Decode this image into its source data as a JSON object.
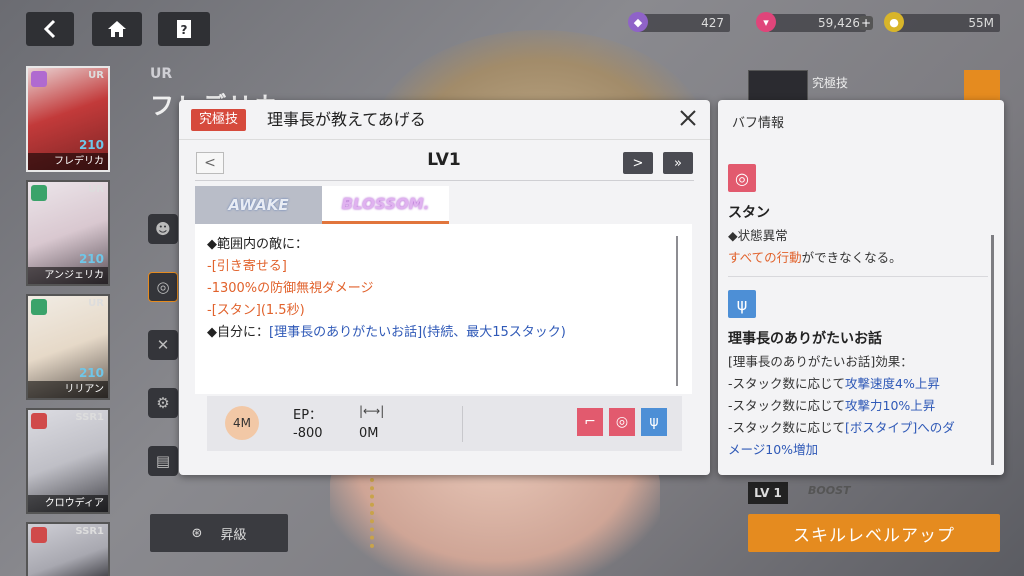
{
  "topbar": {
    "back_icon": "chevron-left-icon",
    "home_icon": "home-icon",
    "help_icon": "help-icon",
    "resources": [
      {
        "name": "gem",
        "value": "427",
        "color": "#8f63c8"
      },
      {
        "name": "ticket",
        "value": "59,426",
        "color": "#e0457a"
      },
      {
        "name": "gold",
        "value": "55M",
        "color": "#d8b52a"
      }
    ]
  },
  "roster": [
    {
      "rarity": "UR",
      "level": "210",
      "name": "フレデリカ",
      "element_color": "#b06ad0",
      "art_color": "#c23a3a",
      "selected": true
    },
    {
      "rarity": "UR",
      "level": "210",
      "name": "アンジェリカ",
      "element_color": "#3aa36a",
      "art_color": "#d9c8d0",
      "selected": false
    },
    {
      "rarity": "UR",
      "level": "210",
      "name": "リリアン",
      "element_color": "#3aa36a",
      "art_color": "#e6d9c8",
      "selected": false
    },
    {
      "rarity": "SSR1",
      "level": "",
      "name": "クロウディア",
      "element_color": "#d04a4a",
      "art_color": "#bfbfc6",
      "selected": false
    },
    {
      "rarity": "SSR1",
      "level": "",
      "name": "",
      "element_color": "#d04a4a",
      "art_color": "#a8a8b0",
      "selected": false
    }
  ],
  "background": {
    "rarity": "UR",
    "char_name": "フレデリカ",
    "promote_label": "昇級",
    "ult_tag": "究極技",
    "level_tag": "LV 1",
    "boost_label": "BOOST",
    "skill_up_label": "スキルレベルアップ"
  },
  "skill_panel": {
    "badge": "究極技",
    "title": "理事長が教えてあげる",
    "level": "LV1",
    "tabs": {
      "awake": "AWAKE",
      "blossom": "BLOSSOM."
    },
    "desc": {
      "line1": "◆範囲内の敵に：",
      "line2": "-[引き寄せる]",
      "line3": "-1300%の防御無視ダメージ",
      "line4": "-[スタン](1.5秒)",
      "line5_prefix": "◆自分に：",
      "line5_rest": "[理事長のありがたいお話](持続、最大15スタック)"
    },
    "range": "4M",
    "ep_label": "EP：",
    "ep_value": "-800",
    "distance_value": "0M",
    "effects": [
      {
        "icon": "hook-icon",
        "color": "#e25a6e"
      },
      {
        "icon": "spiral-icon",
        "color": "#e25a6e"
      },
      {
        "icon": "staff-icon",
        "color": "#4d8fd6"
      }
    ]
  },
  "buff_panel": {
    "title": "バフ情報",
    "stun": {
      "name": "スタン",
      "type": "◆状態異常",
      "desc_highlight": "すべての行動",
      "desc_rest": "ができなくなる。"
    },
    "talk": {
      "name": "理事長のありがたいお話",
      "effect_head": "[理事長のありがたいお話]効果：",
      "line1_prefix": "-スタック数に応じて",
      "line1_highlight": "攻撃速度4%上昇",
      "line2_prefix": "-スタック数に応じて",
      "line2_highlight": "攻撃力10%上昇",
      "line3_prefix": "-スタック数に応じて",
      "line3_highlight": "[ボスタイプ]へのダ",
      "line4_highlight": "メージ10%増加"
    }
  }
}
